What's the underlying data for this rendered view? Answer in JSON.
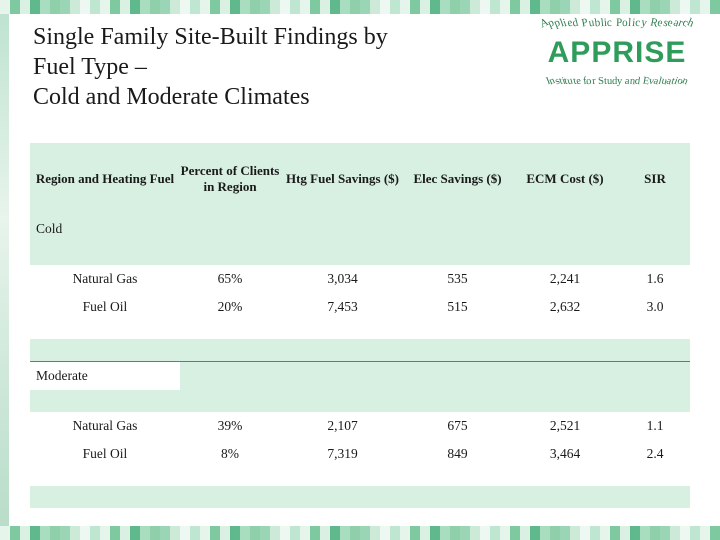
{
  "title": {
    "line1": "Single Family Site-Built Findings by",
    "line2": "Fuel Type –",
    "line3": "Cold and Moderate Climates"
  },
  "logo": {
    "arc_top": "Applied Public Policy Research",
    "brand": "APPRISE",
    "arc_bottom": "Institute for Study and Evaluation"
  },
  "table": {
    "headers": [
      "Region and Heating Fuel",
      "Percent of Clients in Region",
      "Htg Fuel Savings ($)",
      "Elec Savings ($)",
      "ECM Cost ($)",
      "SIR"
    ],
    "groups": [
      {
        "name": "Cold",
        "rows": [
          {
            "label": "Natural Gas",
            "percent": "65%",
            "htg_fuel_savings": "3,034",
            "elec_savings": "535",
            "ecm_cost": "2,241",
            "sir": "1.6"
          },
          {
            "label": "Fuel Oil",
            "percent": "20%",
            "htg_fuel_savings": "7,453",
            "elec_savings": "515",
            "ecm_cost": "2,632",
            "sir": "3.0"
          }
        ]
      },
      {
        "name": "Moderate",
        "rows": [
          {
            "label": "Natural Gas",
            "percent": "39%",
            "htg_fuel_savings": "2,107",
            "elec_savings": "675",
            "ecm_cost": "2,521",
            "sir": "1.1"
          },
          {
            "label": "Fuel Oil",
            "percent": "8%",
            "htg_fuel_savings": "7,319",
            "elec_savings": "849",
            "ecm_cost": "3,464",
            "sir": "2.4"
          }
        ]
      }
    ]
  },
  "colors": {
    "header_fill": "#d8f0e2",
    "accent_green": "#2f9c5c",
    "text": "#1a1a1a"
  }
}
